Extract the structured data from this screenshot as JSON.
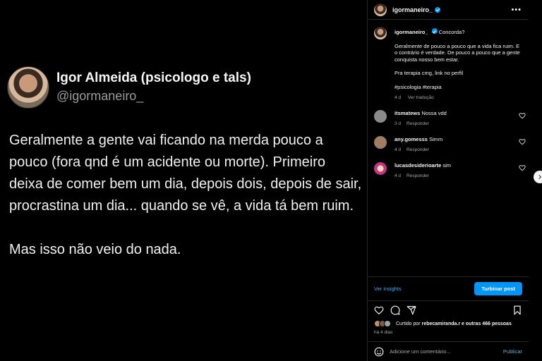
{
  "tweet": {
    "name": "Igor Almeida (psicologo e tals)",
    "handle": "@igormaneiro_",
    "paragraph1": "Geralmente a gente vai ficando na merda pouco a pouco (fora qnd é um acidente ou morte). Primeiro deixa de comer bem um dia, depois dois, depois de sair, procrastina um dia... quando se vê, a vida tá bem ruim.",
    "paragraph2": "Mas isso não veio do nada."
  },
  "header": {
    "username": "igormaneiro_",
    "more_icon": "more-horizontal-icon"
  },
  "caption": {
    "username": "igormaneiro_",
    "first_line": "Concorda?",
    "line2": "Geralmente de pouco a pouco que a vida fica ruim. E o contrário é verdade. De pouco a pouco que a gente conquista nosso bem estar.",
    "line3": "Pra terapia cmg, link no perfil",
    "hashtags": "#psicologia #terapia",
    "time": "4 d",
    "translate": "Ver tradução"
  },
  "comments": [
    {
      "user": "itsmatews",
      "text": "Nossa vdd",
      "time": "3 d",
      "reply": "Responder",
      "avatar_color": "#8a8a8a"
    },
    {
      "user": "any.gomesss",
      "text": "Simm",
      "time": "4 d",
      "reply": "Responder",
      "avatar_color": "#a07d62"
    },
    {
      "user": "lucasdesiderioarte",
      "text": "sim",
      "time": "4 d",
      "reply": "Responder",
      "avatar_color": "#c13584"
    }
  ],
  "insights": {
    "label": "Ver insights",
    "boost": "Turbinar post"
  },
  "likes": {
    "prefix": "Curtido por",
    "user": "rebecamiranda.r",
    "suffix": "e outras 466 pessoas",
    "time": "há 4 dias"
  },
  "comment_box": {
    "placeholder": "Adicione um comentário...",
    "publish": "Publicar"
  },
  "colors": {
    "accent": "#0095f6",
    "link": "#4aa8f0",
    "background": "#000000"
  }
}
